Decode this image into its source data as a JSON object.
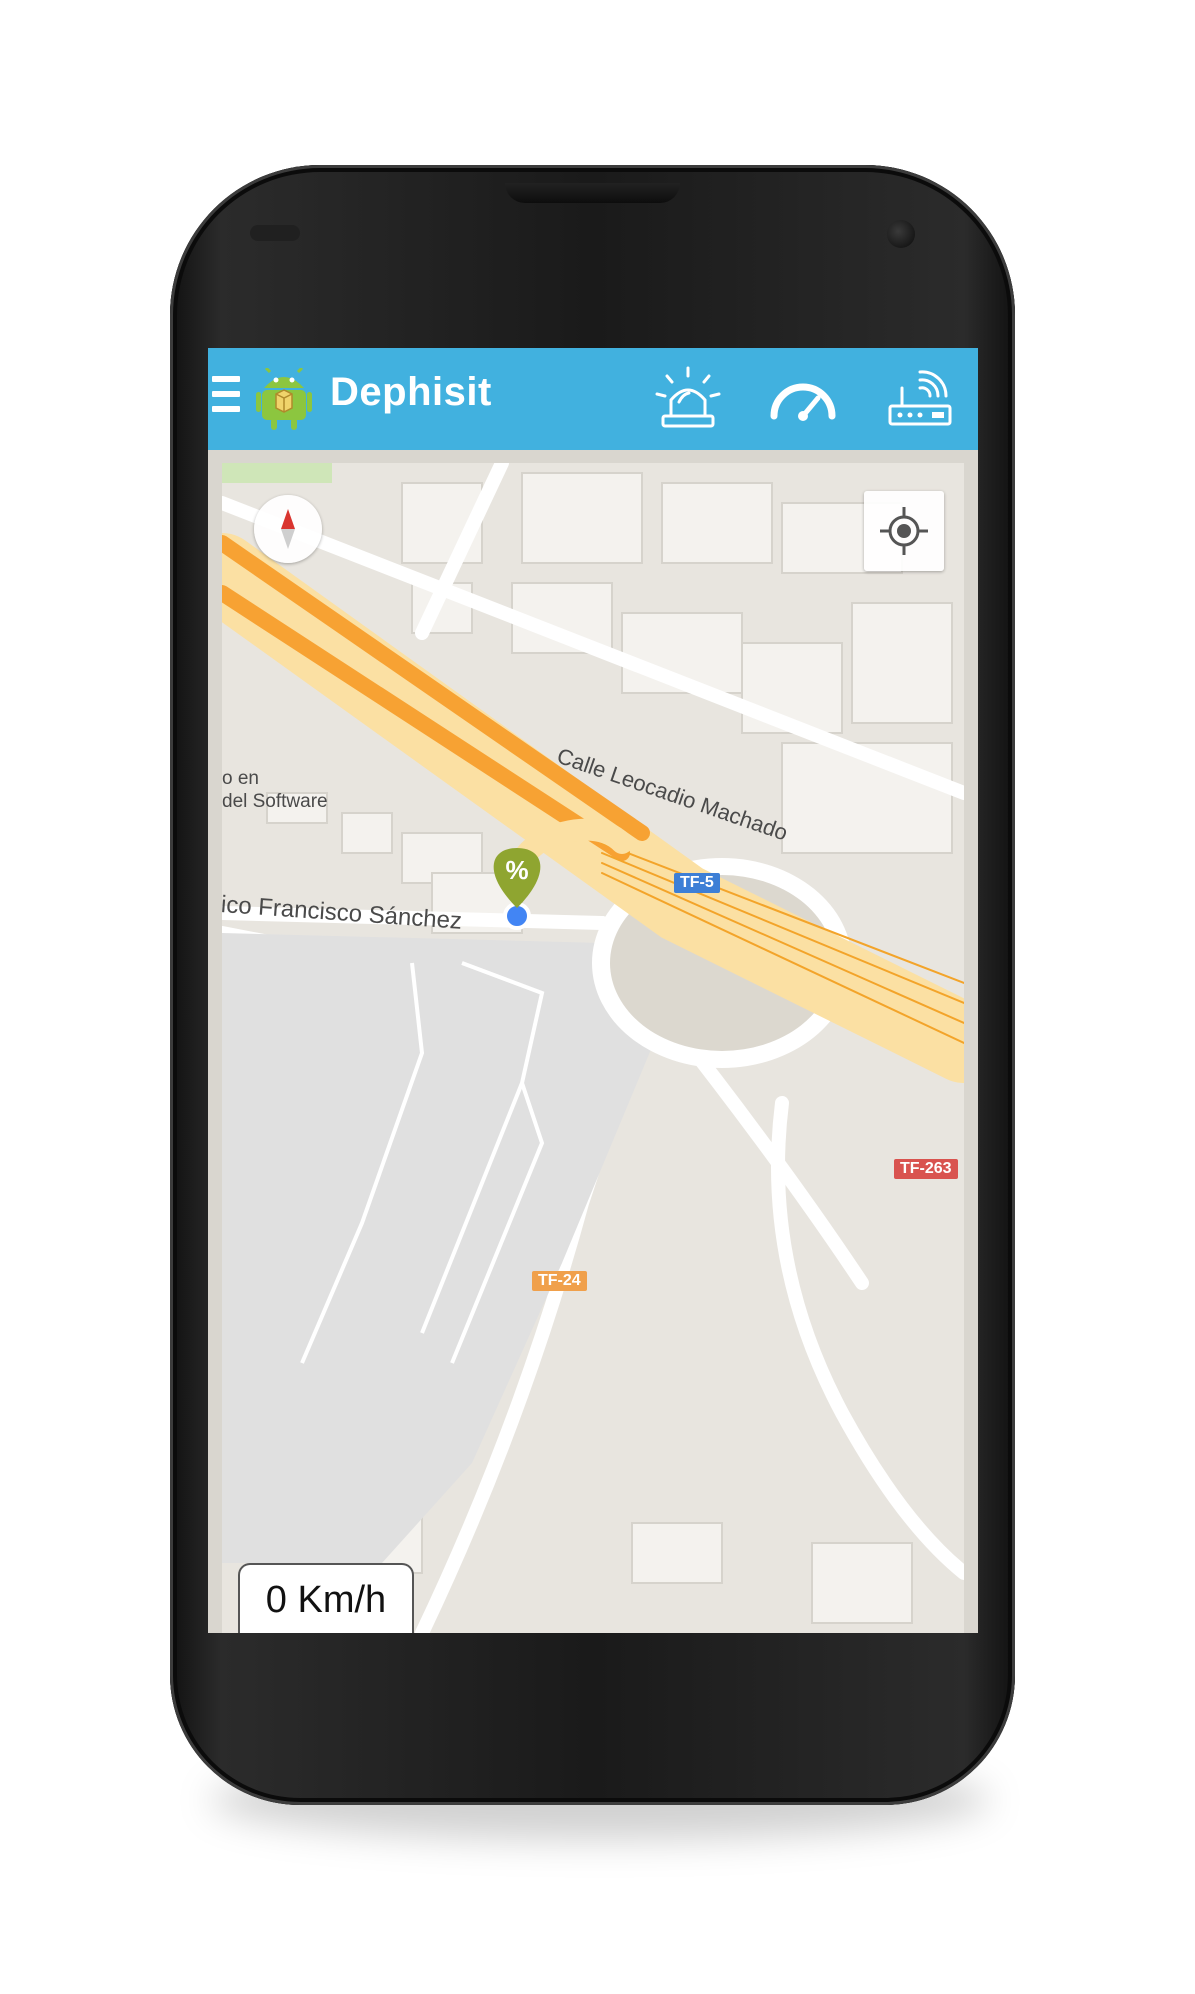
{
  "app": {
    "title": "Dephisit"
  },
  "toolbar": {
    "menu_icon": "hamburger-icon",
    "app_icon": "android-icon",
    "actions": [
      {
        "icon": "alarm-light-icon"
      },
      {
        "icon": "speedometer-icon"
      },
      {
        "icon": "router-wifi-icon"
      }
    ]
  },
  "map": {
    "labels": {
      "street_1": "Calle Leocadio Machado",
      "street_2": "ico Francisco Sánchez",
      "poi_line1": "o en",
      "poi_line2": "del Software"
    },
    "shields": [
      {
        "text": "TF-5",
        "color": "#3d7fd6"
      },
      {
        "text": "TF-263",
        "color": "#d9534f"
      },
      {
        "text": "TF-24",
        "color": "#f0a04b"
      }
    ],
    "marker_symbol": "%",
    "marker_color": "#8fa530",
    "location_dot_color": "#4285f4",
    "highway_color": "#f7a233"
  },
  "speed": {
    "value": "0 Km/h"
  }
}
